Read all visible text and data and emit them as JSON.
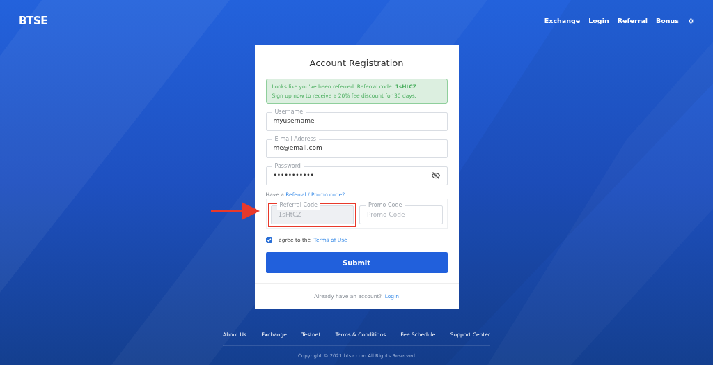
{
  "header": {
    "logo": "BTSE",
    "nav": [
      "Exchange",
      "Login",
      "Referral",
      "Bonus"
    ]
  },
  "card": {
    "title": "Account Registration",
    "notice": {
      "line1": "Looks like you've been referred. Referral code: **1sHtCZ**.",
      "line2": "Sign up now to receive a 20% fee discount for 30 days."
    },
    "fields": [
      {
        "label": "Username",
        "value": "myusername",
        "kind": "text"
      },
      {
        "label": "E-mail Address",
        "value": "me@email.com",
        "kind": "text"
      },
      {
        "label": "Password",
        "value": "•••••••••••",
        "kind": "password"
      }
    ],
    "code_prompt": {
      "text": "Have a",
      "link": "Referral / Promo code?"
    },
    "code_fields": [
      {
        "label": "Referral Code",
        "value": "1sHtCZ",
        "disabled": true,
        "highlighted": true
      },
      {
        "label": "Promo Code",
        "placeholder": "Promo Code",
        "disabled": false,
        "highlighted": false
      }
    ],
    "agree": {
      "checked": true,
      "text": "I agree to the",
      "link": "Terms of Use"
    },
    "submit": "Submit",
    "footer": {
      "text": "Already have an account?",
      "link": "Login"
    }
  },
  "footer": {
    "links": [
      "About Us",
      "Exchange",
      "Testnet",
      "Terms & Conditions",
      "Fee Schedule",
      "Support Center"
    ],
    "copyright": "Copyright © 2021 btse.com All Rights Reserved"
  }
}
